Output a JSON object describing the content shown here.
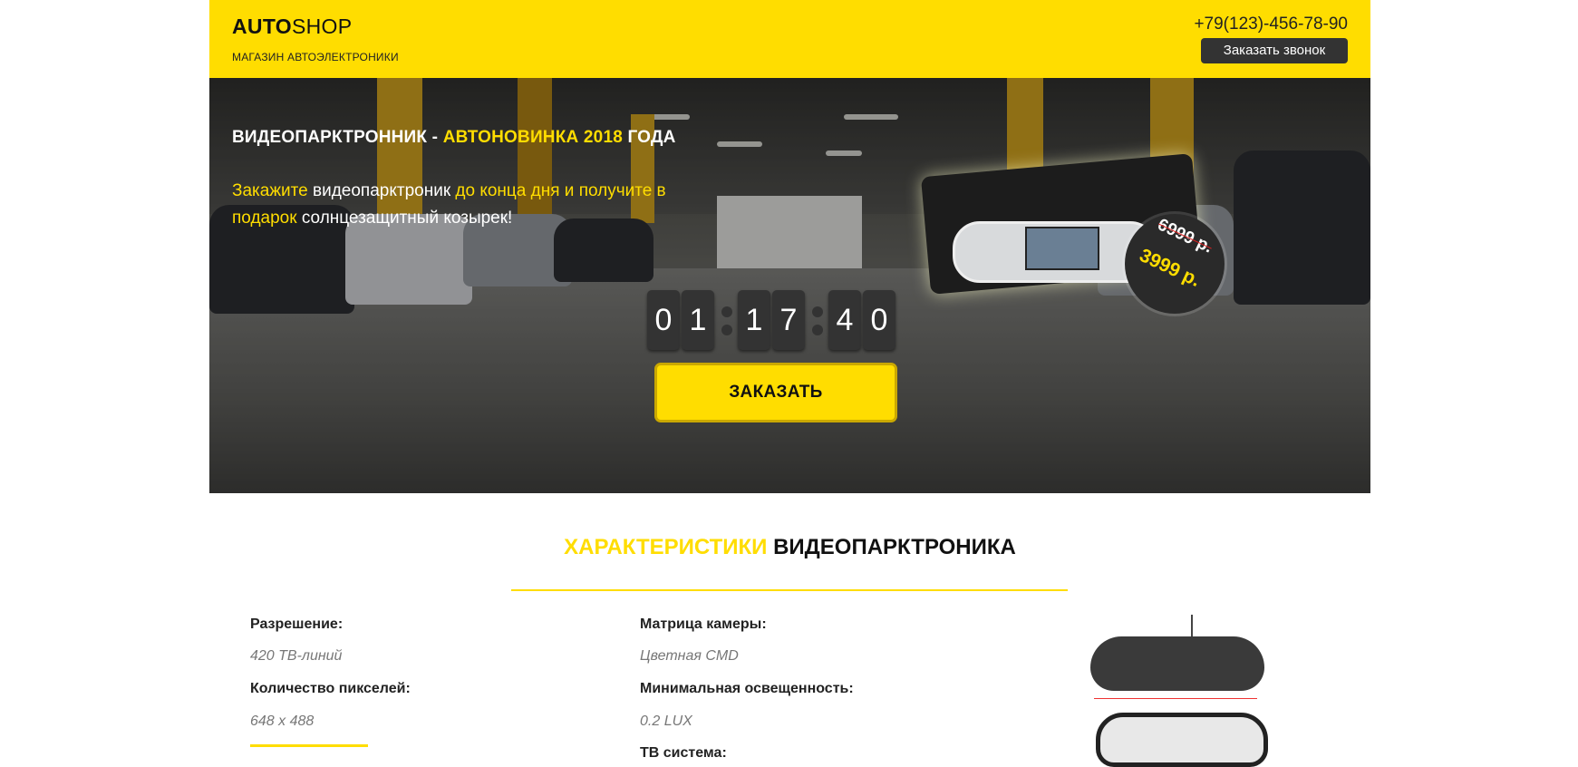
{
  "header": {
    "logo_bold": "AUTO",
    "logo_rest": "SHOP",
    "tagline": "МАГАЗИН АВТОЭЛЕКТРОНИКИ",
    "phone": "+79(123)-456-78-90",
    "callback_label": "Заказать звонок"
  },
  "hero": {
    "title_part1": "ВИДЕОПАРКТРОННИК - ",
    "title_highlight": "АВТОНОВИНКА 2018",
    "title_part2": " ГОДА",
    "sub_y1": "Закажите",
    "sub_w1": " видеопарктроник ",
    "sub_y2": "до конца дня и получите в подарок",
    "sub_w2": " солнцезащитный козырек!",
    "price_old": "6999 р.",
    "price_new": "3999 р.",
    "countdown": [
      "0",
      "1",
      "1",
      "7",
      "4",
      "0"
    ],
    "order_label": "ЗАКАЗАТЬ"
  },
  "specs": {
    "title_highlight": "ХАРАКТЕРИСТИКИ",
    "title_rest": " ВИДЕОПАРКТРОНИКА",
    "col1": [
      {
        "label": "Разрешение:",
        "value": "420 ТВ-линий"
      },
      {
        "label": "Количество пикселей:",
        "value": "648 x 488"
      }
    ],
    "col2": [
      {
        "label": "Матрица камеры:",
        "value": "Цветная CMD"
      },
      {
        "label": "Минимальная освещенность:",
        "value": "0.2 LUX"
      },
      {
        "label": "ТВ  система:"
      }
    ]
  },
  "colors": {
    "accent": "#ffdd00",
    "dark": "#333333"
  }
}
